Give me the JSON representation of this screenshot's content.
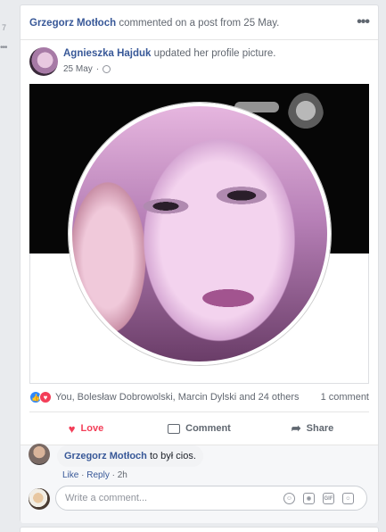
{
  "sidebar": {
    "number": "7",
    "more": "•••"
  },
  "story": {
    "actor": "Grzegorz Motłoch",
    "text": "commented on a post from 25 May.",
    "menu": "•••"
  },
  "post": {
    "author": "Agnieszka Hajduk",
    "action": "updated her profile picture.",
    "date": "25 May",
    "separator": "·"
  },
  "reactions": {
    "like_glyph": "👍",
    "love_glyph": "♥",
    "summary": "You, Bolesław Dobrowolski, Marcin Dylski and 24 others",
    "comment_count": "1 comment"
  },
  "actions": {
    "love": "Love",
    "comment": "Comment",
    "share": "Share"
  },
  "comment": {
    "author": "Grzegorz Motłoch",
    "text": "to był cios.",
    "like": "Like",
    "dot": "·",
    "reply": "Reply",
    "time": "2h"
  },
  "composer": {
    "placeholder": "Write a comment...",
    "icons": [
      "emoji-icon",
      "camera-icon",
      "gif-icon",
      "sticker-icon"
    ]
  },
  "colors": {
    "link": "#385898",
    "love": "#f33e58",
    "like": "#2d88ff"
  }
}
